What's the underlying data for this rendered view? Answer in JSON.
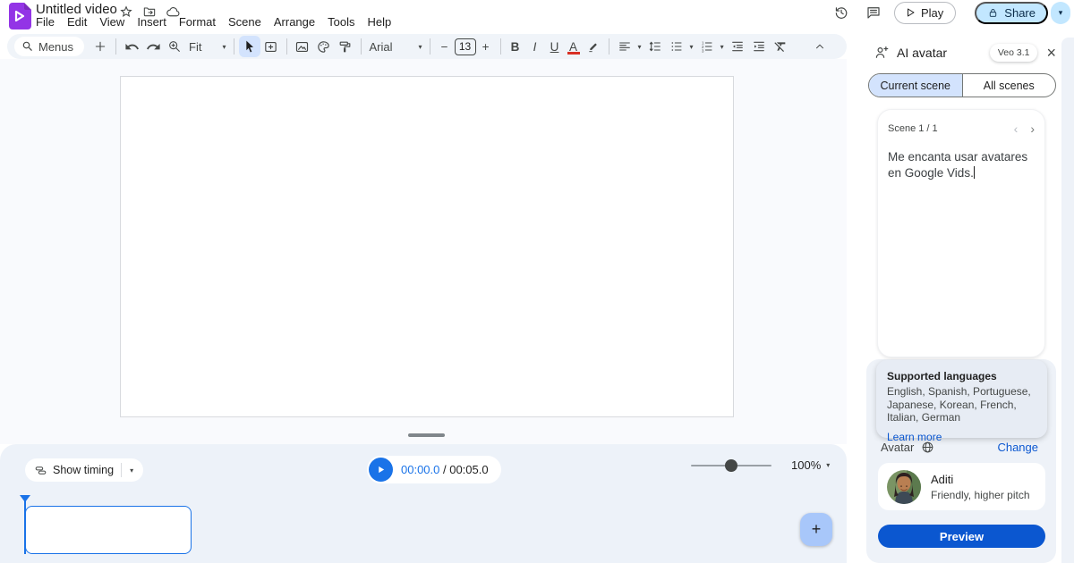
{
  "header": {
    "title": "Untitled video",
    "menus": [
      "File",
      "Edit",
      "View",
      "Insert",
      "Format",
      "Scene",
      "Arrange",
      "Tools",
      "Help"
    ],
    "play_label": "Play",
    "share_label": "Share"
  },
  "toolbar": {
    "menus_label": "Menus",
    "fit_label": "Fit",
    "font_family": "Arial",
    "font_size": "13",
    "bold": "B",
    "italic": "I",
    "underline": "U",
    "text_color": "A",
    "minus": "−",
    "plus": "+"
  },
  "glyphs": {
    "caret_down": "▾",
    "chevron_left": "‹",
    "chevron_right": "›",
    "close": "×",
    "plus": "+"
  },
  "bottom_bar": {
    "show_timing_label": "Show timing",
    "current_time": "00:00.0",
    "time_separator": " / ",
    "total_time": "00:05.0",
    "zoom_level": "100%",
    "add_scene_label": "+"
  },
  "right_panel": {
    "title": "AI avatar",
    "badge": "Veo 3.1",
    "tabs": [
      {
        "label": "Current scene"
      },
      {
        "label": "All scenes"
      }
    ],
    "scene": {
      "label": "Scene 1 / 1",
      "script": "Me encanta usar avatares en Google Vids."
    },
    "languages": {
      "title": "Supported languages",
      "list": "English, Spanish, Portuguese, Japanese, Korean, French, Italian, German",
      "link": "Learn more"
    },
    "avatar_section": {
      "label": "Avatar",
      "change_label": "Change",
      "name": "Aditi",
      "voice": "Friendly, higher pitch",
      "preview_label": "Preview"
    }
  },
  "colors": {
    "accent_blue": "#1a73e8",
    "link_blue": "#0b57d0",
    "selected_blue": "#d3e3fd",
    "share_blue": "#c2e7ff",
    "toolbar_bg": "#f0f4f9",
    "timeline_bg": "#edf2f9",
    "brand_purple": "#9334e6"
  }
}
